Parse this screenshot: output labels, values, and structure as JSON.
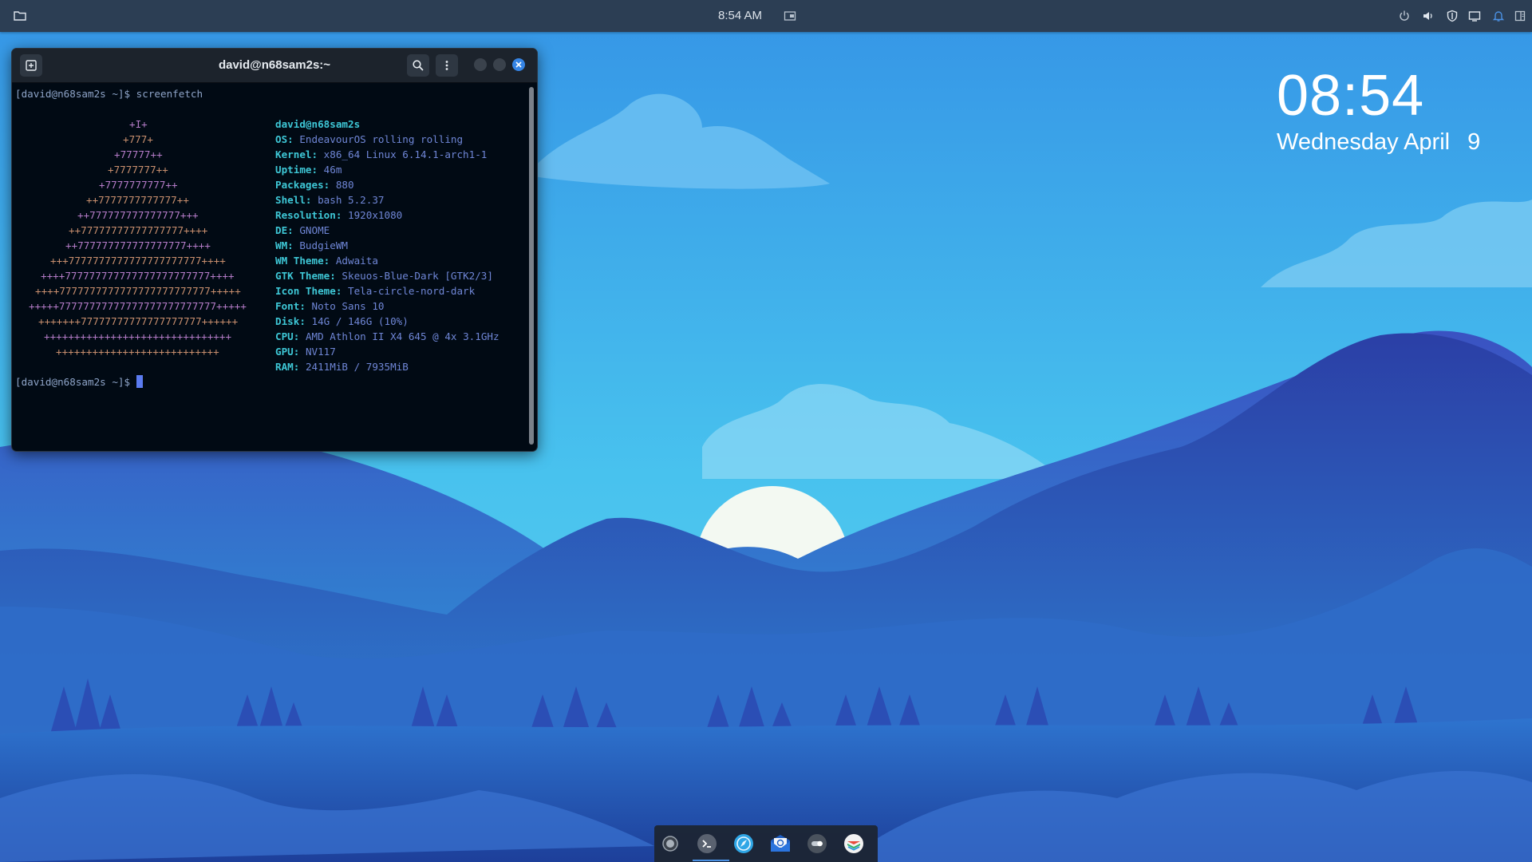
{
  "panel": {
    "clock": "8:54 AM",
    "icons": [
      "folder-icon",
      "screen-icon",
      "power-icon",
      "volume-icon",
      "shield-icon",
      "display-icon",
      "bell-icon",
      "sidebar-icon"
    ]
  },
  "desktop_clock": {
    "time": "08:54",
    "date": "Wednesday April",
    "day": "9"
  },
  "terminal": {
    "title": "david@n68sam2s:~",
    "prompt": "[david@n68sam2s ~]$",
    "command": "screenfetch",
    "logo_lines": [
      "+I+",
      "+777+",
      "+77777++",
      "+7777777++",
      "+7777777777++",
      "++7777777777777++",
      "++777777777777777+++",
      "++77777777777777777++++",
      "++777777777777777777++++",
      "+++7777777777777777777777++++",
      "++++777777777777777777777777++++",
      "++++7777777777777777777777777+++++",
      "+++++77777777777777777777777777+++++",
      "+++++++77777777777777777777++++++",
      "+++++++++++++++++++++++++++++++",
      "+++++++++++++++++++++++++++"
    ],
    "info": {
      "user": "david@n68sam2s",
      "rows": [
        {
          "key": "OS:",
          "value": "EndeavourOS rolling rolling"
        },
        {
          "key": "Kernel:",
          "value": "x86_64 Linux 6.14.1-arch1-1"
        },
        {
          "key": "Uptime:",
          "value": "46m"
        },
        {
          "key": "Packages:",
          "value": "880"
        },
        {
          "key": "Shell:",
          "value": "bash 5.2.37"
        },
        {
          "key": "Resolution:",
          "value": "1920x1080"
        },
        {
          "key": "DE:",
          "value": "GNOME"
        },
        {
          "key": "WM:",
          "value": "BudgieWM"
        },
        {
          "key": "WM Theme:",
          "value": "Adwaita"
        },
        {
          "key": "GTK Theme:",
          "value": "Skeuos-Blue-Dark [GTK2/3]"
        },
        {
          "key": "Icon Theme:",
          "value": "Tela-circle-nord-dark"
        },
        {
          "key": "Font:",
          "value": "Noto Sans 10"
        },
        {
          "key": "Disk:",
          "value": "14G / 146G (10%)"
        },
        {
          "key": "CPU:",
          "value": "AMD Athlon II X4 645 @ 4x 3.1GHz"
        },
        {
          "key": "GPU:",
          "value": "NV117"
        },
        {
          "key": "RAM:",
          "value": "2411MiB / 7935MiB"
        }
      ]
    }
  },
  "dock": {
    "items": [
      {
        "name": "screen-recorder-icon"
      },
      {
        "name": "terminal-icon"
      },
      {
        "name": "browser-icon"
      },
      {
        "name": "mail-icon"
      },
      {
        "name": "settings-toggle-icon"
      },
      {
        "name": "app-store-icon"
      }
    ]
  },
  "colors": {
    "panel": "#2c3e54",
    "terminal_bg": "#010a14",
    "accent": "#4a90e2",
    "info_key": "#3ec7d6",
    "info_value": "#6f86d6"
  }
}
